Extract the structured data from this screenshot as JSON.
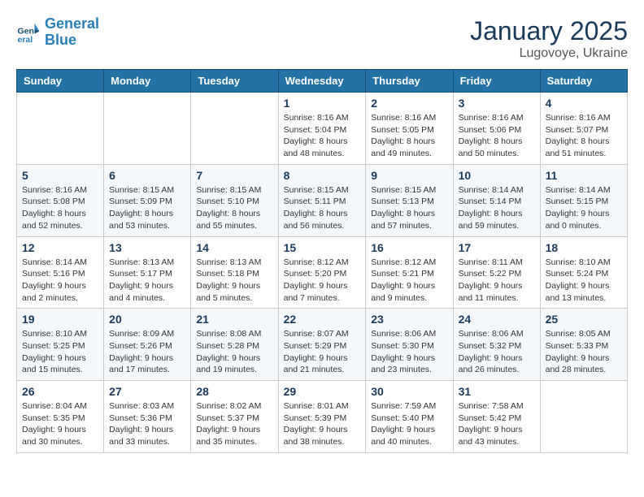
{
  "header": {
    "logo_line1": "General",
    "logo_line2": "Blue",
    "month_title": "January 2025",
    "location": "Lugovoye, Ukraine"
  },
  "weekdays": [
    "Sunday",
    "Monday",
    "Tuesday",
    "Wednesday",
    "Thursday",
    "Friday",
    "Saturday"
  ],
  "weeks": [
    [
      {
        "day": "",
        "info": ""
      },
      {
        "day": "",
        "info": ""
      },
      {
        "day": "",
        "info": ""
      },
      {
        "day": "1",
        "info": "Sunrise: 8:16 AM\nSunset: 5:04 PM\nDaylight: 8 hours\nand 48 minutes."
      },
      {
        "day": "2",
        "info": "Sunrise: 8:16 AM\nSunset: 5:05 PM\nDaylight: 8 hours\nand 49 minutes."
      },
      {
        "day": "3",
        "info": "Sunrise: 8:16 AM\nSunset: 5:06 PM\nDaylight: 8 hours\nand 50 minutes."
      },
      {
        "day": "4",
        "info": "Sunrise: 8:16 AM\nSunset: 5:07 PM\nDaylight: 8 hours\nand 51 minutes."
      }
    ],
    [
      {
        "day": "5",
        "info": "Sunrise: 8:16 AM\nSunset: 5:08 PM\nDaylight: 8 hours\nand 52 minutes."
      },
      {
        "day": "6",
        "info": "Sunrise: 8:15 AM\nSunset: 5:09 PM\nDaylight: 8 hours\nand 53 minutes."
      },
      {
        "day": "7",
        "info": "Sunrise: 8:15 AM\nSunset: 5:10 PM\nDaylight: 8 hours\nand 55 minutes."
      },
      {
        "day": "8",
        "info": "Sunrise: 8:15 AM\nSunset: 5:11 PM\nDaylight: 8 hours\nand 56 minutes."
      },
      {
        "day": "9",
        "info": "Sunrise: 8:15 AM\nSunset: 5:13 PM\nDaylight: 8 hours\nand 57 minutes."
      },
      {
        "day": "10",
        "info": "Sunrise: 8:14 AM\nSunset: 5:14 PM\nDaylight: 8 hours\nand 59 minutes."
      },
      {
        "day": "11",
        "info": "Sunrise: 8:14 AM\nSunset: 5:15 PM\nDaylight: 9 hours\nand 0 minutes."
      }
    ],
    [
      {
        "day": "12",
        "info": "Sunrise: 8:14 AM\nSunset: 5:16 PM\nDaylight: 9 hours\nand 2 minutes."
      },
      {
        "day": "13",
        "info": "Sunrise: 8:13 AM\nSunset: 5:17 PM\nDaylight: 9 hours\nand 4 minutes."
      },
      {
        "day": "14",
        "info": "Sunrise: 8:13 AM\nSunset: 5:18 PM\nDaylight: 9 hours\nand 5 minutes."
      },
      {
        "day": "15",
        "info": "Sunrise: 8:12 AM\nSunset: 5:20 PM\nDaylight: 9 hours\nand 7 minutes."
      },
      {
        "day": "16",
        "info": "Sunrise: 8:12 AM\nSunset: 5:21 PM\nDaylight: 9 hours\nand 9 minutes."
      },
      {
        "day": "17",
        "info": "Sunrise: 8:11 AM\nSunset: 5:22 PM\nDaylight: 9 hours\nand 11 minutes."
      },
      {
        "day": "18",
        "info": "Sunrise: 8:10 AM\nSunset: 5:24 PM\nDaylight: 9 hours\nand 13 minutes."
      }
    ],
    [
      {
        "day": "19",
        "info": "Sunrise: 8:10 AM\nSunset: 5:25 PM\nDaylight: 9 hours\nand 15 minutes."
      },
      {
        "day": "20",
        "info": "Sunrise: 8:09 AM\nSunset: 5:26 PM\nDaylight: 9 hours\nand 17 minutes."
      },
      {
        "day": "21",
        "info": "Sunrise: 8:08 AM\nSunset: 5:28 PM\nDaylight: 9 hours\nand 19 minutes."
      },
      {
        "day": "22",
        "info": "Sunrise: 8:07 AM\nSunset: 5:29 PM\nDaylight: 9 hours\nand 21 minutes."
      },
      {
        "day": "23",
        "info": "Sunrise: 8:06 AM\nSunset: 5:30 PM\nDaylight: 9 hours\nand 23 minutes."
      },
      {
        "day": "24",
        "info": "Sunrise: 8:06 AM\nSunset: 5:32 PM\nDaylight: 9 hours\nand 26 minutes."
      },
      {
        "day": "25",
        "info": "Sunrise: 8:05 AM\nSunset: 5:33 PM\nDaylight: 9 hours\nand 28 minutes."
      }
    ],
    [
      {
        "day": "26",
        "info": "Sunrise: 8:04 AM\nSunset: 5:35 PM\nDaylight: 9 hours\nand 30 minutes."
      },
      {
        "day": "27",
        "info": "Sunrise: 8:03 AM\nSunset: 5:36 PM\nDaylight: 9 hours\nand 33 minutes."
      },
      {
        "day": "28",
        "info": "Sunrise: 8:02 AM\nSunset: 5:37 PM\nDaylight: 9 hours\nand 35 minutes."
      },
      {
        "day": "29",
        "info": "Sunrise: 8:01 AM\nSunset: 5:39 PM\nDaylight: 9 hours\nand 38 minutes."
      },
      {
        "day": "30",
        "info": "Sunrise: 7:59 AM\nSunset: 5:40 PM\nDaylight: 9 hours\nand 40 minutes."
      },
      {
        "day": "31",
        "info": "Sunrise: 7:58 AM\nSunset: 5:42 PM\nDaylight: 9 hours\nand 43 minutes."
      },
      {
        "day": "",
        "info": ""
      }
    ]
  ]
}
